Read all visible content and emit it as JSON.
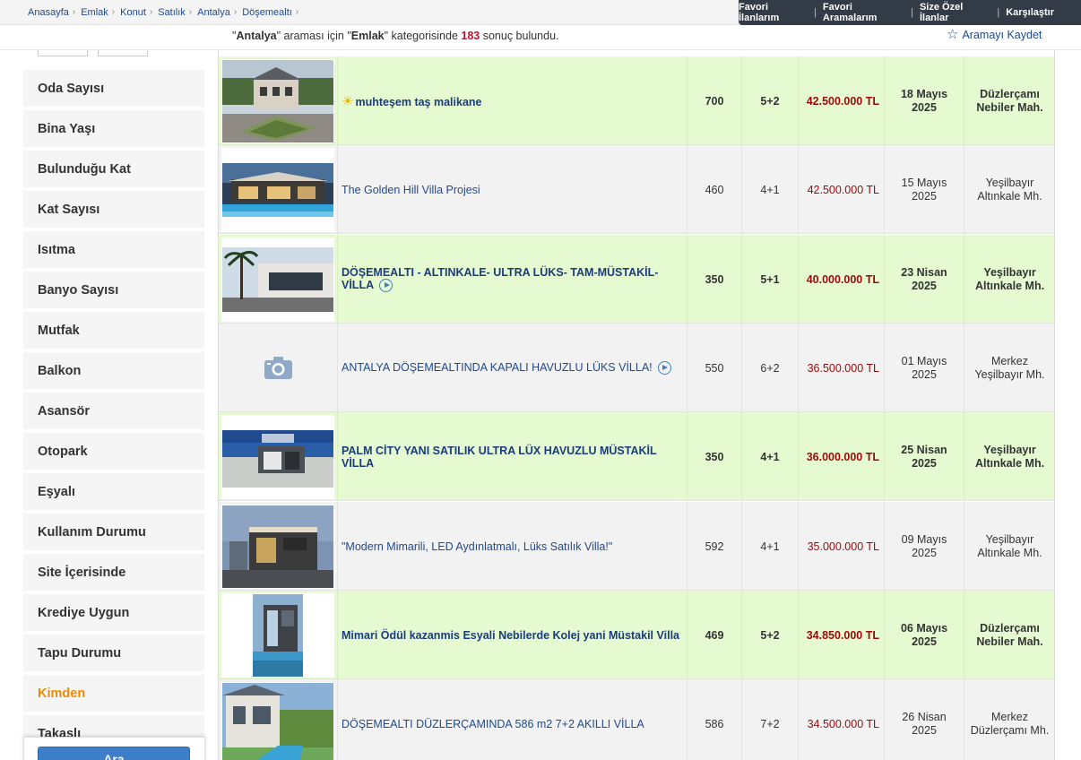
{
  "breadcrumb": [
    "Anasayfa",
    "Emlak",
    "Konut",
    "Satılık",
    "Antalya",
    "Döşemealtı"
  ],
  "topnav": [
    "Favori İlanlarım",
    "Favori Aramalarım",
    "Size Özel İlanlar",
    "Karşılaştır"
  ],
  "info": {
    "q1": "\"",
    "city": "Antalya",
    "q2": "\" araması için \"",
    "cat": "Emlak",
    "q3": "\" kategorisinde ",
    "count": "183",
    "q4": " sonuç bulundu.",
    "save_label": "Aramayı Kaydet"
  },
  "sidebar": {
    "filters": [
      "Oda Sayısı",
      "Bina Yaşı",
      "Bulunduğu Kat",
      "Kat Sayısı",
      "Isıtma",
      "Banyo Sayısı",
      "Mutfak",
      "Balkon",
      "Asansör",
      "Otopark",
      "Eşyalı",
      "Kullanım Durumu",
      "Site İçerisinde",
      "Krediye Uygun",
      "Tapu Durumu",
      "Kimden",
      "Takaslı"
    ],
    "search_button": "Ara"
  },
  "listings": [
    {
      "title": "muhteşem taş malikane",
      "m2": "700",
      "rooms": "5+2",
      "price": "42.500.000 TL",
      "date1": "18 Mayıs",
      "date2": "2025",
      "loc1": "Düzlerçamı",
      "loc2": "Nebiler Mah.",
      "highlight": true,
      "thumb": "stone-mansion"
    },
    {
      "title": "The Golden Hill Villa Projesi",
      "m2": "460",
      "rooms": "4+1",
      "price": "42.500.000 TL",
      "date1": "15 Mayıs",
      "date2": "2025",
      "loc1": "Yeşilbayır",
      "loc2": "Altınkale Mh.",
      "highlight": false,
      "thumb": "modern-villa-pool"
    },
    {
      "title": "DÖŞEMEALTI - ALTINKALE- ULTRA LÜKS- TAM-MÜSTAKİL- VİLLA",
      "m2": "350",
      "rooms": "5+1",
      "price": "40.000.000 TL",
      "date1": "23 Nisan",
      "date2": "2025",
      "loc1": "Yeşilbayır",
      "loc2": "Altınkale Mh.",
      "highlight": true,
      "thumb": "palm-villa"
    },
    {
      "title": "ANTALYA DÖŞEMEALTINDA KAPALI HAVUZLU LÜKS VİLLA!",
      "m2": "550",
      "rooms": "6+2",
      "price": "36.500.000 TL",
      "date1": "01 Mayıs",
      "date2": "2025",
      "loc1": "Merkez",
      "loc2": "Yeşilbayır Mh.",
      "highlight": false,
      "thumb": "none"
    },
    {
      "title": "PALM CİTY YANI SATILIK ULTRA LÜX HAVUZLU MÜSTAKİL VİLLA",
      "m2": "350",
      "rooms": "4+1",
      "price": "36.000.000 TL",
      "date1": "25 Nisan",
      "date2": "2025",
      "loc1": "Yeşilbayır",
      "loc2": "Altınkale Mh.",
      "highlight": true,
      "thumb": "palm-city-villa"
    },
    {
      "title": "\"Modern Mimarili, LED Aydınlatmalı, Lüks Satılık Villa!\"",
      "m2": "592",
      "rooms": "4+1",
      "price": "35.000.000 TL",
      "date1": "09 Mayıs",
      "date2": "2025",
      "loc1": "Yeşilbayır",
      "loc2": "Altınkale Mh.",
      "highlight": false,
      "thumb": "led-villa"
    },
    {
      "title": "Mimari Ödül kazanmis Esyali Nebilerde Kolej yani Müstakil Villa",
      "m2": "469",
      "rooms": "5+2",
      "price": "34.850.000 TL",
      "date1": "06 Mayıs",
      "date2": "2025",
      "loc1": "Düzlerçamı",
      "loc2": "Nebiler Mah.",
      "highlight": true,
      "thumb": "award-villa"
    },
    {
      "title": "DÖŞEMEALTI DÜZLERÇAMINDA 586 m2 7+2 AKILLI VİLLA",
      "m2": "586",
      "rooms": "7+2",
      "price": "34.500.000 TL",
      "date1": "26 Nisan",
      "date2": "2025",
      "loc1": "Merkez",
      "loc2": "Düzlerçamı Mh.",
      "highlight": false,
      "thumb": "smart-villa"
    }
  ],
  "colors": {
    "highlight_row": "#e5fad1",
    "normal_row": "#f2f2f2",
    "price": "#9b0a0a",
    "link": "#1f4a8e",
    "kimden": "#f08a00"
  }
}
